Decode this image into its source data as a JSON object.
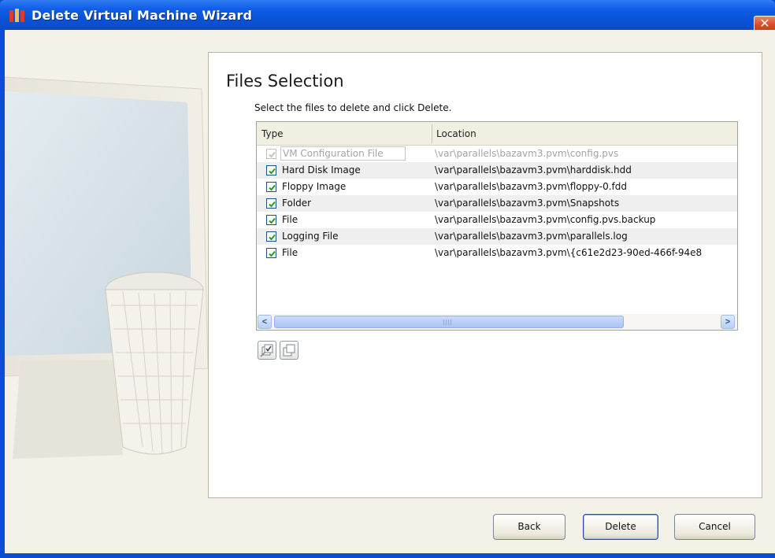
{
  "window": {
    "title": "Delete Virtual Machine Wizard",
    "close_glyph": "✕"
  },
  "page": {
    "heading": "Files Selection",
    "subtitle": "Select the files to delete and click Delete."
  },
  "file_list": {
    "columns": [
      "Type",
      "Location"
    ],
    "rows": [
      {
        "type": "VM Configuration File",
        "location": "\\var\\parallels\\bazavm3.pvm\\config.pvs",
        "checked": true,
        "disabled": true
      },
      {
        "type": "Hard Disk Image",
        "location": "\\var\\parallels\\bazavm3.pvm\\harddisk.hdd",
        "checked": true,
        "disabled": false
      },
      {
        "type": "Floppy Image",
        "location": "\\var\\parallels\\bazavm3.pvm\\floppy-0.fdd",
        "checked": true,
        "disabled": false
      },
      {
        "type": "Folder",
        "location": "\\var\\parallels\\bazavm3.pvm\\Snapshots",
        "checked": true,
        "disabled": false
      },
      {
        "type": "File",
        "location": "\\var\\parallels\\bazavm3.pvm\\config.pvs.backup",
        "checked": true,
        "disabled": false
      },
      {
        "type": "Logging File",
        "location": "\\var\\parallels\\bazavm3.pvm\\parallels.log",
        "checked": true,
        "disabled": false
      },
      {
        "type": "File",
        "location": "\\var\\parallels\\bazavm3.pvm\\{c61e2d23-90ed-466f-94e8",
        "checked": true,
        "disabled": false
      }
    ],
    "scroll_left_glyph": "<",
    "scroll_right_glyph": ">"
  },
  "list_tools": {
    "select_all_icon": "check-all-icon",
    "clear_all_icon": "uncheck-all-icon"
  },
  "buttons": {
    "back": "Back",
    "delete": "Delete",
    "cancel": "Cancel"
  },
  "colors": {
    "title_bar": "#0a4ed6",
    "close_button": "#d84e2b",
    "dialog_background": "#f3f1e8",
    "checkbox_border": "#1c5180",
    "check_mark": "#21a121"
  }
}
